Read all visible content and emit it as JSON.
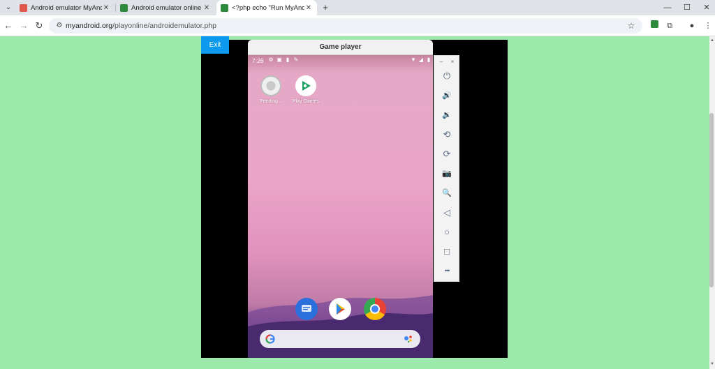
{
  "browser": {
    "tabs": [
      {
        "title": "Android emulator MyAndroid",
        "close": "✕"
      },
      {
        "title": "Android emulator online - M",
        "close": "✕"
      },
      {
        "title": "<?php echo \"Run MyAndroid",
        "close": "✕"
      }
    ],
    "active_tab": 2,
    "new_tab": "+",
    "url_host": "myandroid.org",
    "url_path": "/playonline/androidemulator.php",
    "window_controls": {
      "minimize": "—",
      "maximize": "☐",
      "close": "✕"
    }
  },
  "page": {
    "exit_label": "Exit",
    "player_title": "Game player",
    "colors": {
      "background": "#9de9ab",
      "exit_button": "#0d9aee"
    }
  },
  "phone": {
    "status_time": "7:26",
    "apps": [
      {
        "label": "Pending...",
        "icon": "pending-app-icon"
      },
      {
        "label": "Play Games",
        "icon": "play-games-icon"
      }
    ],
    "dock": [
      {
        "icon": "messages-icon"
      },
      {
        "icon": "play-store-icon"
      },
      {
        "icon": "chrome-icon"
      }
    ],
    "search_icon": "google-g-icon",
    "assistant_icon": "google-assistant-icon"
  },
  "side_toolbar": {
    "minimize": "–",
    "close": "×",
    "buttons": [
      {
        "name": "power-icon",
        "glyph": "⏻"
      },
      {
        "name": "volume-up-icon",
        "glyph": "🔊"
      },
      {
        "name": "volume-down-icon",
        "glyph": "🔉"
      },
      {
        "name": "rotate-left-icon",
        "glyph": "⟲"
      },
      {
        "name": "rotate-right-icon",
        "glyph": "⟳"
      },
      {
        "name": "camera-icon",
        "glyph": "📷"
      },
      {
        "name": "zoom-icon",
        "glyph": "🔍"
      },
      {
        "name": "back-icon",
        "glyph": "◁"
      },
      {
        "name": "home-icon",
        "glyph": "○"
      },
      {
        "name": "overview-icon",
        "glyph": "□"
      },
      {
        "name": "more-icon",
        "glyph": "•••"
      }
    ]
  }
}
